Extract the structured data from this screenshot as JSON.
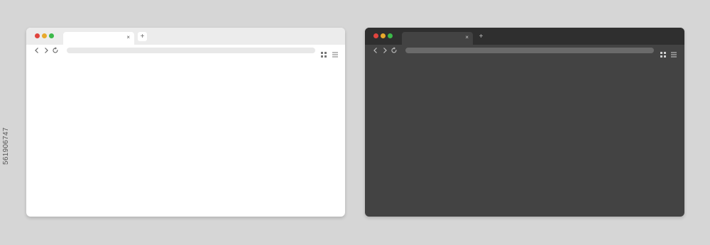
{
  "colors": {
    "background": "#d6d6d6",
    "traffic_red": "#e0443e",
    "traffic_yellow": "#e8a92c",
    "traffic_green": "#3cb94a",
    "light_icon": "#666666",
    "dark_icon": "#bfbfbf"
  },
  "browsers": [
    {
      "theme": "light",
      "tab_close_glyph": "×",
      "new_tab_glyph": "+",
      "url_value": "",
      "icons": [
        "back-icon",
        "forward-icon",
        "reload-icon",
        "apps-grid-icon",
        "menu-icon"
      ]
    },
    {
      "theme": "dark",
      "tab_close_glyph": "×",
      "new_tab_glyph": "+",
      "url_value": "",
      "icons": [
        "back-icon",
        "forward-icon",
        "reload-icon",
        "apps-grid-icon",
        "menu-icon"
      ]
    }
  ],
  "stock_id": "561906747"
}
